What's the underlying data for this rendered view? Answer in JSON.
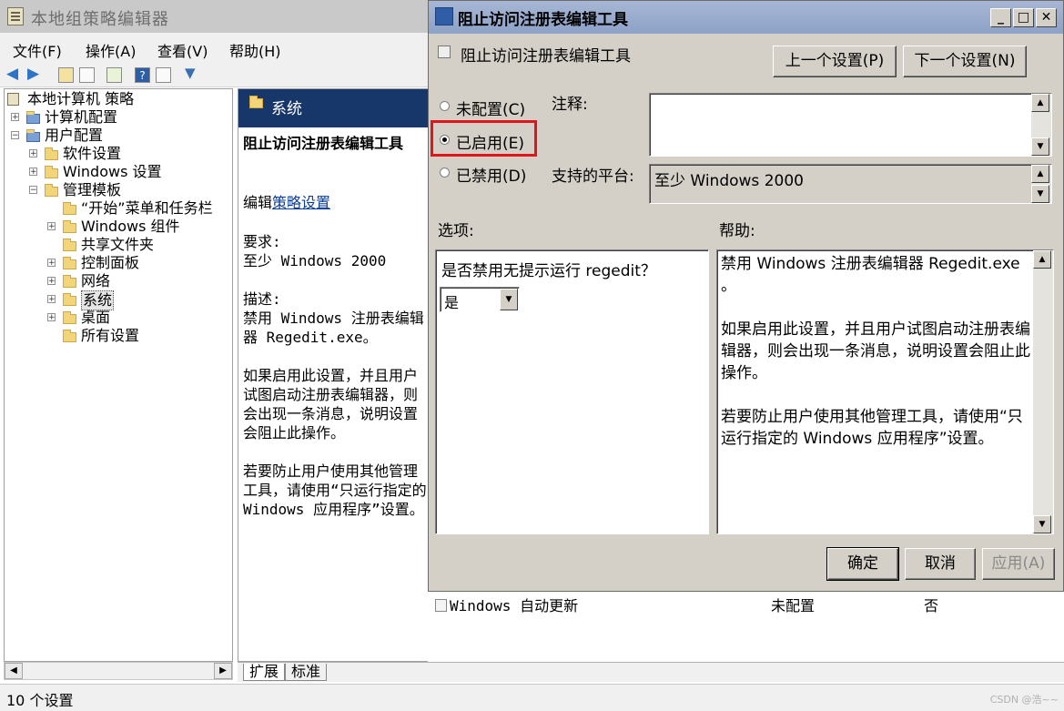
{
  "main_window": {
    "title": "本地组策略编辑器"
  },
  "menu": [
    "文件(F)",
    "操作(A)",
    "查看(V)",
    "帮助(H)"
  ],
  "tree": {
    "root": "本地计算机 策略",
    "items": [
      {
        "label": "计算机配置",
        "level": 1,
        "expander": "+"
      },
      {
        "label": "用户配置",
        "level": 1,
        "expander": "-"
      },
      {
        "label": "软件设置",
        "level": 2,
        "expander": "+"
      },
      {
        "label": "Windows 设置",
        "level": 2,
        "expander": "+"
      },
      {
        "label": "管理模板",
        "level": 2,
        "expander": "-"
      },
      {
        "label": "“开始”菜单和任务栏",
        "level": 3,
        "expander": ""
      },
      {
        "label": "Windows 组件",
        "level": 3,
        "expander": "+"
      },
      {
        "label": "共享文件夹",
        "level": 3,
        "expander": ""
      },
      {
        "label": "控制面板",
        "level": 3,
        "expander": "+"
      },
      {
        "label": "网络",
        "level": 3,
        "expander": "+"
      },
      {
        "label": "系统",
        "level": 3,
        "expander": "+",
        "selected": true
      },
      {
        "label": "桌面",
        "level": 3,
        "expander": "+"
      },
      {
        "label": "所有设置",
        "level": 3,
        "expander": ""
      }
    ]
  },
  "detail": {
    "header": "系统",
    "setting_title": "阻止访问注册表编辑工具",
    "edit_prefix": "编辑",
    "edit_link": "策略设置",
    "requirement_label": "要求:",
    "requirement_value": "至少 Windows 2000",
    "description_label": "描述:",
    "description": "禁用 Windows 注册表编辑器 Regedit.exe。",
    "paragraph_1": "如果启用此设置，并且用户试图启动注册表编辑器，则会出现一条消息，说明设置会阻止此操作。",
    "paragraph_2": "若要防止用户使用其他管理工具，请使用“只运行指定的 Windows 应用程序”设置。"
  },
  "tabs": [
    "扩展",
    "标准"
  ],
  "list_row": {
    "name": "Windows 自动更新",
    "state": "未配置",
    "comment": "否"
  },
  "status": "10 个设置",
  "watermark": "CSDN @浩~~",
  "dialog": {
    "title": "阻止访问注册表编辑工具",
    "setting_name": "阻止访问注册表编辑工具",
    "prev_button": "上一个设置(P)",
    "next_button": "下一个设置(N)",
    "radio_not_configured": "未配置(C)",
    "radio_enabled": "已启用(E)",
    "radio_disabled": "已禁用(D)",
    "selected_option": "已启用(E)",
    "comment_label": "注释:",
    "comment_value": "",
    "platform_label": "支持的平台:",
    "platform_value": "至少 Windows 2000",
    "options_label": "选项:",
    "help_label": "帮助:",
    "option_question": "是否禁用无提示运行 regedit？",
    "option_select_value": "是",
    "help_line_1": "禁用 Windows 注册表编辑器 Regedit.exe",
    "help_line_1b": "。",
    "help_para_2": "如果启用此设置，并且用户试图启动注册表编辑器，则会出现一条消息，说明设置会阻止此操作。",
    "help_para_3": "若要防止用户使用其他管理工具，请使用“只运行指定的 Windows 应用程序”设置。",
    "ok_button": "确定",
    "cancel_button": "取消",
    "apply_button": "应用(A)"
  },
  "colors": {
    "detail_header_bg": "#17376b",
    "highlight": "#e0161c",
    "dialog_bg": "#d4d0c8"
  }
}
